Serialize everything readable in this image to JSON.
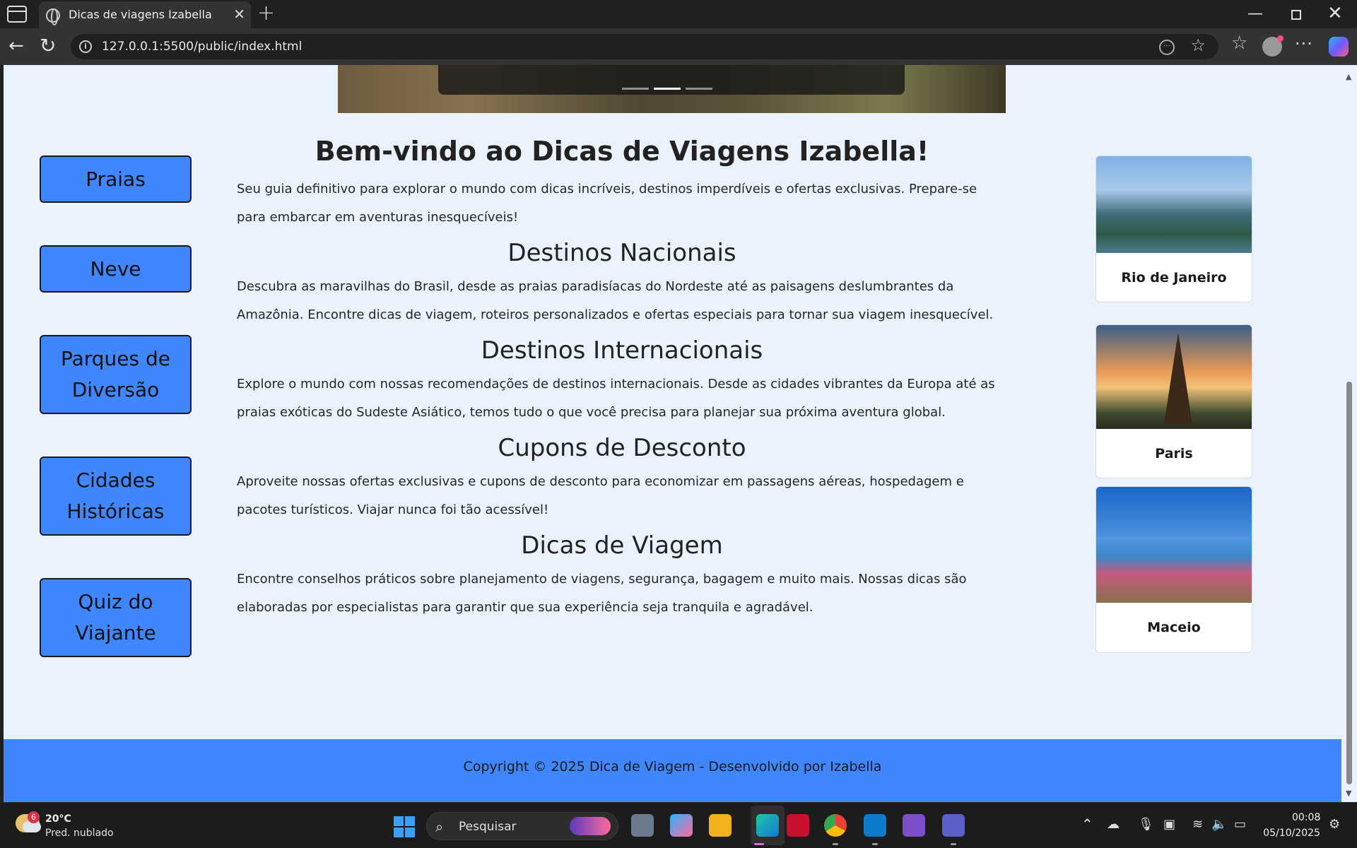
{
  "browser": {
    "tab_title": "Dicas de viagens Izabella",
    "url": "127.0.0.1:5500/public/index.html"
  },
  "sidebar": {
    "items": [
      {
        "label": "Praias"
      },
      {
        "label": "Neve"
      },
      {
        "label": "Parques de Diversão"
      },
      {
        "label": "Cidades Históricas"
      },
      {
        "label": "Quiz do Viajante"
      }
    ]
  },
  "main": {
    "title": "Bem-vindo ao Dicas de Viagens Izabella!",
    "intro": "Seu guia definitivo para explorar o mundo com dicas incríveis, destinos imperdíveis e ofertas exclusivas. Prepare-se para embarcar em aventuras inesquecíveis!",
    "sections": [
      {
        "heading": "Destinos Nacionais",
        "text": "Descubra as maravilhas do Brasil, desde as praias paradisíacas do Nordeste até as paisagens deslumbrantes da Amazônia. Encontre dicas de viagem, roteiros personalizados e ofertas especiais para tornar sua viagem inesquecível."
      },
      {
        "heading": "Destinos Internacionais",
        "text": "Explore o mundo com nossas recomendações de destinos internacionais. Desde as cidades vibrantes da Europa até as praias exóticas do Sudeste Asiático, temos tudo o que você precisa para planejar sua próxima aventura global."
      },
      {
        "heading": "Cupons de Desconto",
        "text": "Aproveite nossas ofertas exclusivas e cupons de desconto para economizar em passagens aéreas, hospedagem e pacotes turísticos. Viajar nunca foi tão acessível!"
      },
      {
        "heading": "Dicas de Viagem",
        "text": "Encontre conselhos práticos sobre planejamento de viagens, segurança, bagagem e muito mais. Nossas dicas são elaboradas por especialistas para garantir que sua experiência seja tranquila e agradável."
      }
    ]
  },
  "cards": [
    {
      "label": "Rio de Janeiro"
    },
    {
      "label": "Paris"
    },
    {
      "label": "Maceio"
    }
  ],
  "carousel": {
    "active_indicator": 2,
    "indicator_count": 3
  },
  "footer": {
    "text": "Copyright © 2025 Dica de Viagem - Desenvolvido por Izabella"
  },
  "taskbar": {
    "weather_temp": "20°C",
    "weather_desc": "Pred. nublado",
    "weather_badge": "6",
    "search_placeholder": "Pesquisar",
    "time": "00:08",
    "date": "05/10/2025"
  },
  "colors": {
    "accent": "#4087ff",
    "page_bg": "#e9f2fd"
  }
}
